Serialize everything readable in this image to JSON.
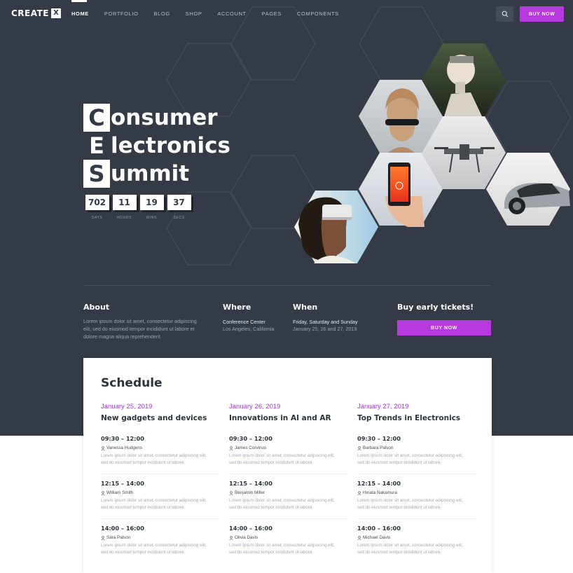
{
  "nav": {
    "logo_text": "CREATE",
    "logo_mark": "X",
    "items": [
      {
        "label": "HOME"
      },
      {
        "label": "PORTFOLIO"
      },
      {
        "label": "BLOG"
      },
      {
        "label": "SHOP"
      },
      {
        "label": "ACCOUNT"
      },
      {
        "label": "PAGES"
      },
      {
        "label": "COMPONENTS"
      }
    ],
    "active_item": "HOME",
    "search_icon": "search-icon",
    "buy_label": "BUY NOW"
  },
  "hero": {
    "title_lines": [
      {
        "initial": "C",
        "rest": "onsumer"
      },
      {
        "initial": "E",
        "rest": "lectronics"
      },
      {
        "initial": "S",
        "rest": "ummit"
      }
    ],
    "countdown": [
      {
        "value": "702",
        "label": "DAYS"
      },
      {
        "value": "11",
        "label": "HOURS"
      },
      {
        "value": "19",
        "label": "MINS"
      },
      {
        "value": "37",
        "label": "SECS"
      }
    ],
    "photos": [
      "humanoid-robot",
      "vr-headset-woman",
      "drone",
      "smartphone-in-hand",
      "electric-car",
      "vr-goggles-woman"
    ]
  },
  "info": {
    "about_title": "About",
    "about_text_1": "Lorem ipsum dolor sit amet, consectetur adipiscing",
    "about_text_2": "elit, sed do eiusmod tempor incididunt ut labore et",
    "about_text_3": "dolore magna aliqua reprehenderit.",
    "where_title": "Where",
    "where_venue": "Conference Center",
    "where_city": "Los Angeles, California",
    "when_title": "When",
    "when_days": "Friday, Saturday and Sunday",
    "when_dates": "January 25, 26 and 27, 2019",
    "tickets_title": "Buy early tickets!",
    "tickets_button": "BUY NOW"
  },
  "schedule": {
    "title": "Schedule",
    "days": [
      {
        "date": "January 25, 2019",
        "heading": "New gadgets and devices",
        "slots": [
          {
            "time": "09:30 – 12:00",
            "speaker": "Vanessa Hudgens",
            "desc_1": "Lorem ipsum dolor sit amet, consectetur adipiscing elit,",
            "desc_2": "sed do eiusmod tempor incididunt ut labore."
          },
          {
            "time": "12:15 – 14:00",
            "speaker": "William Smith",
            "desc_1": "Lorem ipsum dolor sit amet, consectetur adipiscing elit,",
            "desc_2": "sed do eiusmod tempor incididunt ut labore."
          },
          {
            "time": "14:00 – 16:00",
            "speaker": "Sara Palson",
            "desc_1": "Lorem ipsum dolor sit amet, consectetur adipiscing elit,",
            "desc_2": "sed do eiusmod tempor incididunt ut labore."
          }
        ]
      },
      {
        "date": "January 26, 2019",
        "heading": "Innovations in AI and AR",
        "slots": [
          {
            "time": "09:30 – 12:00",
            "speaker": "James Corvinus",
            "desc_1": "Lorem ipsum dolor sit amet, consectetur adipiscing elit,",
            "desc_2": "sed do eiusmod tempor incididunt ut labore."
          },
          {
            "time": "12:15 – 14:00",
            "speaker": "Benjamin Miller",
            "desc_1": "Lorem ipsum dolor sit amet, consectetur adipiscing elit,",
            "desc_2": "sed do eiusmod tempor incididunt ut labore."
          },
          {
            "time": "14:00 – 16:00",
            "speaker": "Olivia Davis",
            "desc_1": "Lorem ipsum dolor sit amet, consectetur adipiscing elit,",
            "desc_2": "sed do eiusmod tempor incididunt ut labore."
          }
        ]
      },
      {
        "date": "January 27, 2019",
        "heading": "Top Trends in Electronics",
        "slots": [
          {
            "time": "09:30 – 12:00",
            "speaker": "Barbara Palson",
            "desc_1": "Lorem ipsum dolor sit amet, consectetur adipiscing elit,",
            "desc_2": "sed do eiusmod tempor incididunt ut labore."
          },
          {
            "time": "12:15 – 14:00",
            "speaker": "Hinata Nakamura",
            "desc_1": "Lorem ipsum dolor sit amet, consectetur adipiscing elit,",
            "desc_2": "sed do eiusmod tempor incididunt ut labore."
          },
          {
            "time": "14:00 – 16:00",
            "speaker": "Michael Davis",
            "desc_1": "Lorem ipsum dolor sit amet, consectetur adipiscing elit,",
            "desc_2": "sed do eiusmod tempor incididunt ut labore."
          }
        ]
      }
    ]
  },
  "colors": {
    "hero_bg": "#343a46",
    "accent": "#b73adf",
    "date_accent": "#a53ad2",
    "card_bg": "#ffffff"
  }
}
